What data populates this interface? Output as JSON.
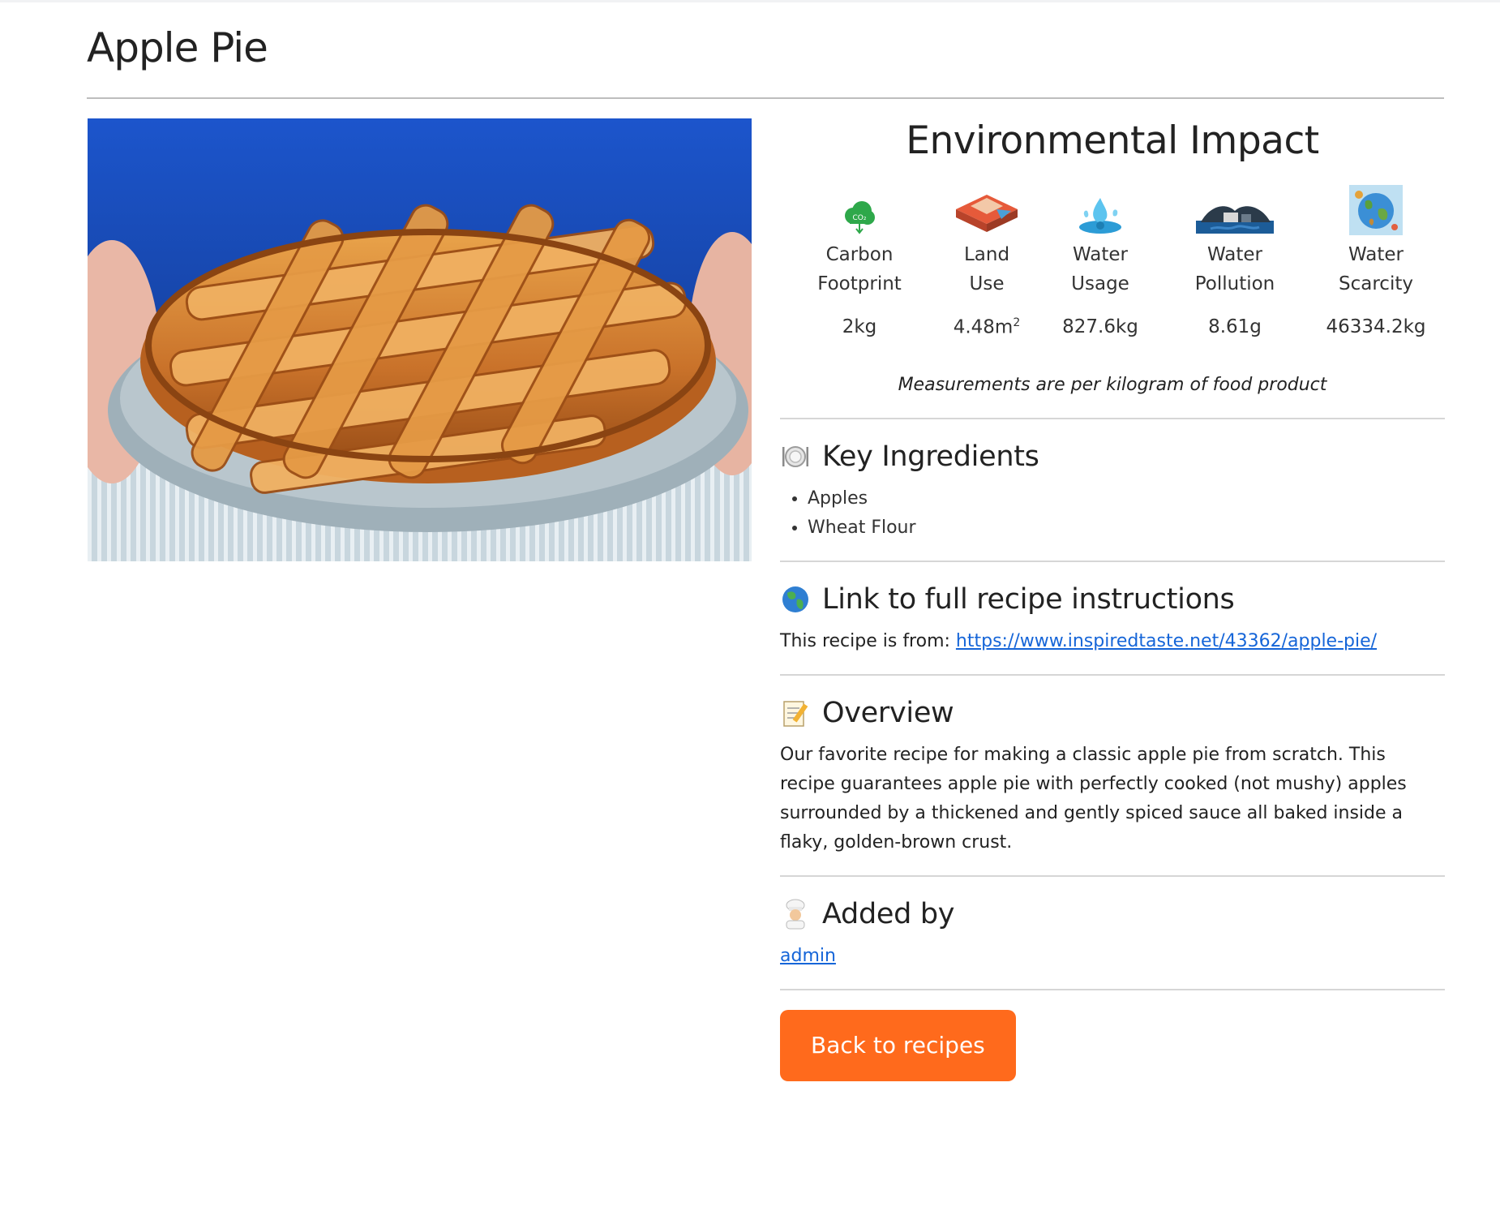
{
  "page": {
    "title": "Apple Pie"
  },
  "hero": {
    "alt": "Apple pie with lattice crust"
  },
  "environment": {
    "title": "Environmental Impact",
    "metrics": [
      {
        "key": "carbon",
        "label": "Carbon\nFootprint",
        "value": "2kg",
        "icon": "co2-cloud-icon"
      },
      {
        "key": "land",
        "label": "Land\nUse",
        "value": "4.48m",
        "sup": "2",
        "icon": "land-icon"
      },
      {
        "key": "water-usage",
        "label": "Water\nUsage",
        "value": "827.6kg",
        "icon": "water-splash-icon"
      },
      {
        "key": "water-pollution",
        "label": "Water\nPollution",
        "value": "8.61g",
        "icon": "pollution-icon"
      },
      {
        "key": "water-scarcity",
        "label": "Water\nScarcity",
        "value": "46334.2kg",
        "icon": "globe-scarcity-icon"
      }
    ],
    "note": "Measurements are per kilogram of food product"
  },
  "ingredients": {
    "heading": "Key Ingredients",
    "icon": "plate-icon",
    "items": [
      "Apples",
      "Wheat Flour"
    ]
  },
  "recipe_link": {
    "heading": "Link to full recipe instructions",
    "icon": "globe-icon",
    "prefix": "This recipe is from: ",
    "url": "https://www.inspiredtaste.net/43362/apple-pie/"
  },
  "overview": {
    "heading": "Overview",
    "icon": "memo-icon",
    "text": "Our favorite recipe for making a classic apple pie from scratch. This recipe guarantees apple pie with perfectly cooked (not mushy) apples surrounded by a thickened and gently spiced sauce all baked inside a flaky, golden-brown crust."
  },
  "added_by": {
    "heading": "Added by",
    "icon": "chef-icon",
    "user": "admin"
  },
  "actions": {
    "back_label": "Back to recipes"
  },
  "colors": {
    "accent": "#ff6a1c",
    "link": "#1565d8"
  }
}
